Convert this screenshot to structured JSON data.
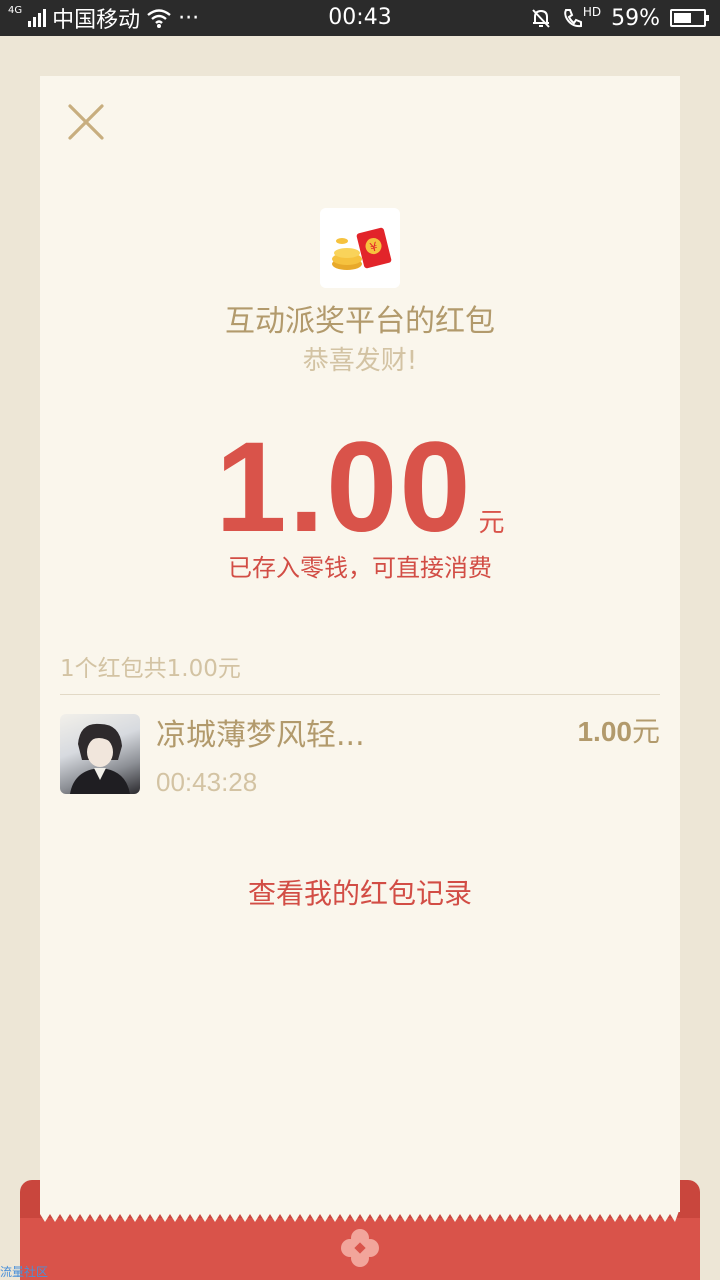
{
  "status_bar": {
    "network": "4G",
    "carrier": "中国移动",
    "more": "···",
    "time": "00:43",
    "hd": "HD",
    "battery_percent": "59%",
    "battery_level": 0.59
  },
  "red_packet": {
    "title": "互动派奖平台的红包",
    "greeting": "恭喜发财!",
    "amount": "1.00",
    "amount_unit": "元",
    "stored_message": "已存入零钱，可直接消费",
    "summary": "1个红包共1.00元",
    "records_link": "查看我的红包记录"
  },
  "receivers": [
    {
      "name": "凉城薄梦风轻...",
      "time": "00:43:28",
      "amount": "1.00",
      "unit": "元"
    }
  ],
  "watermark": "流量社区",
  "colors": {
    "accent_red": "#d9534a",
    "gold_text": "#b29a6c",
    "card_bg": "#faf6ec"
  }
}
